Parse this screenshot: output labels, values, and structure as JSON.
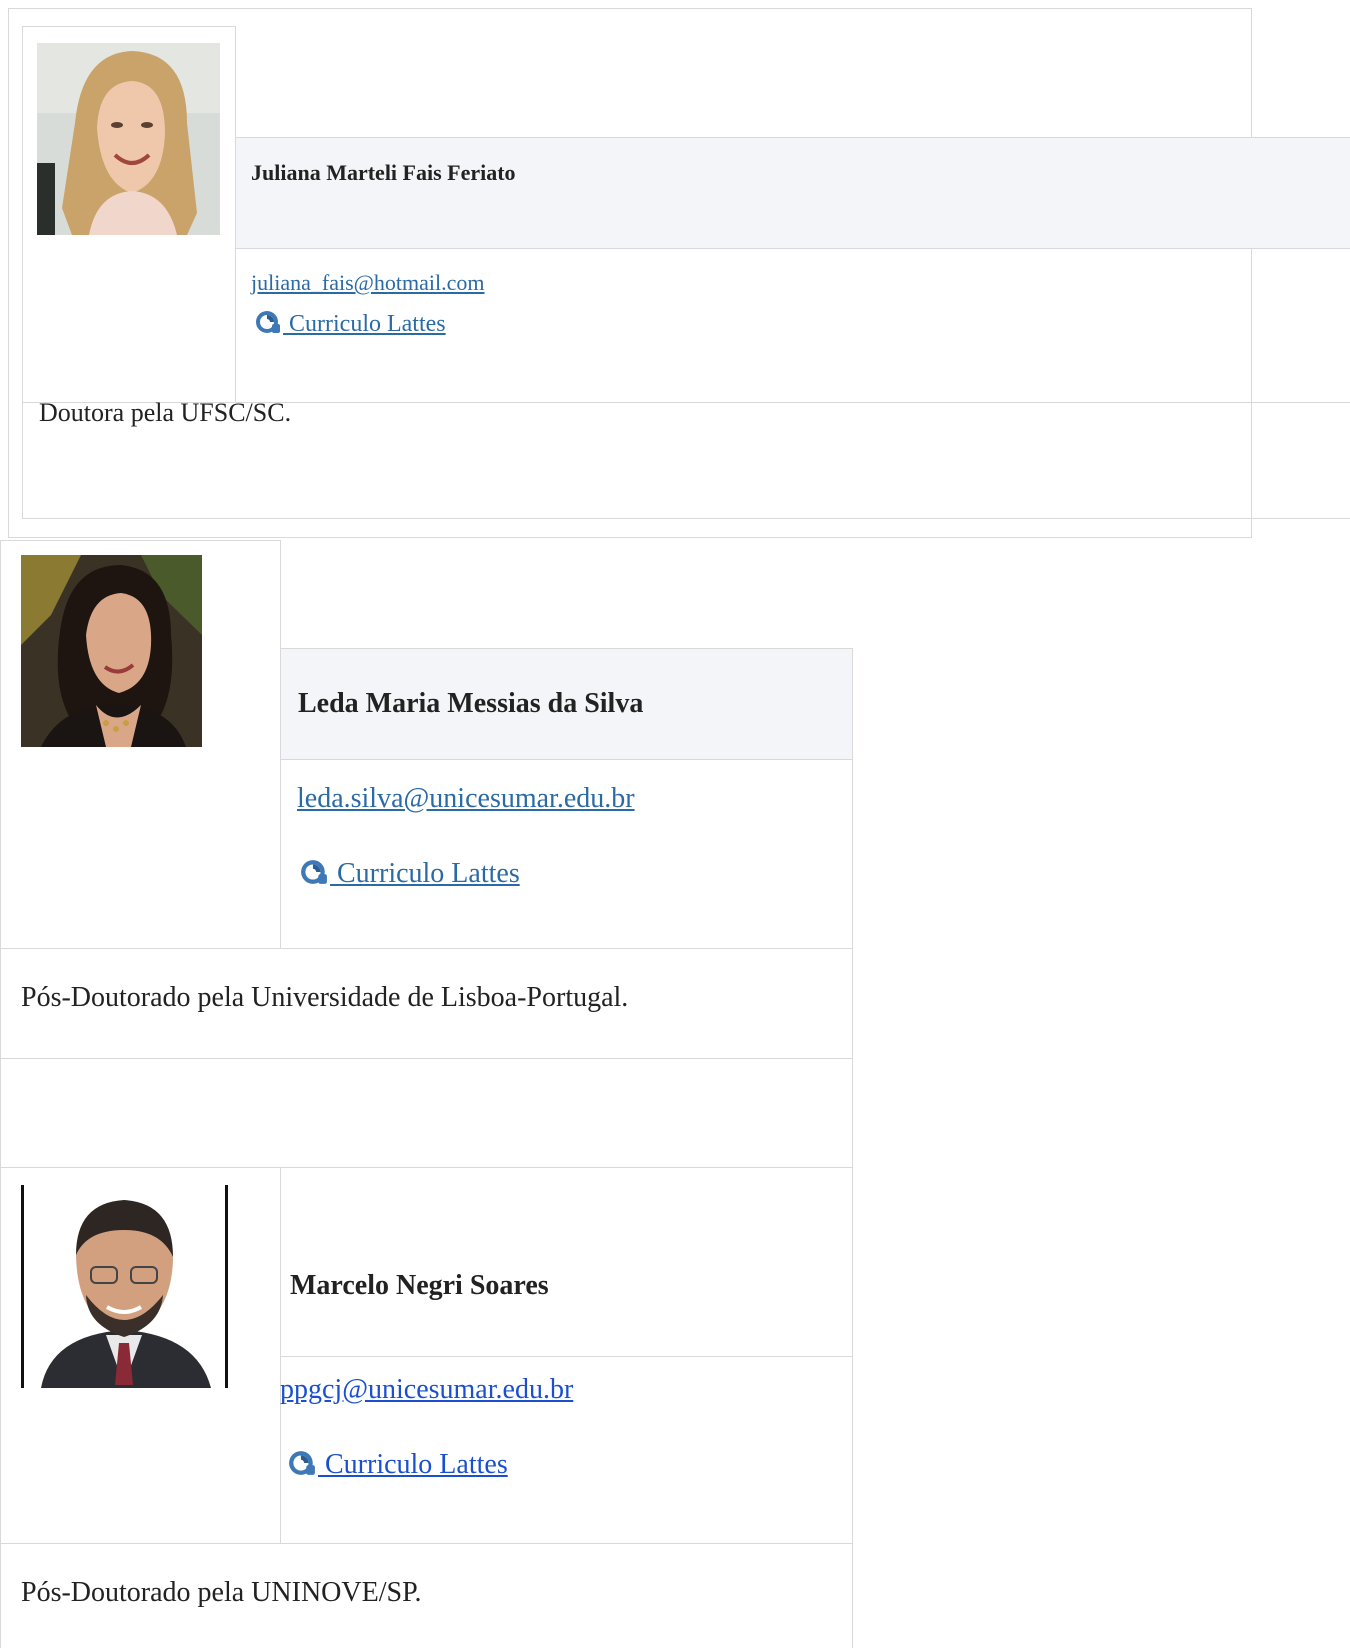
{
  "profiles": [
    {
      "name": "Juliana Marteli Fais Feriato",
      "email": " juliana_fais@hotmail.com ",
      "lattes_label": " Curriculo Lattes",
      "description": "Doutora pela UFSC/SC."
    },
    {
      "name": "Leda Maria Messias da Silva",
      "email": " leda.silva@unicesumar.edu.br ",
      "lattes_label": " Curriculo Lattes",
      "description": "Pós-Doutorado pela Universidade de Lisboa-Portugal."
    },
    {
      "name": "Marcelo Negri Soares",
      "email": " ppgcj@unicesumar.edu.br",
      "lattes_label": " Curriculo Lattes",
      "description": "Pós-Doutorado pela UNINOVE/SP."
    }
  ],
  "icons": {
    "lattes": "lattes-icon",
    "photo": "person-photo"
  },
  "colors": {
    "border": "#d9d9d9",
    "name_row_bg": "#f3f5f8",
    "link": "#2a6aa5",
    "link_dark": "#1a4fcf"
  }
}
